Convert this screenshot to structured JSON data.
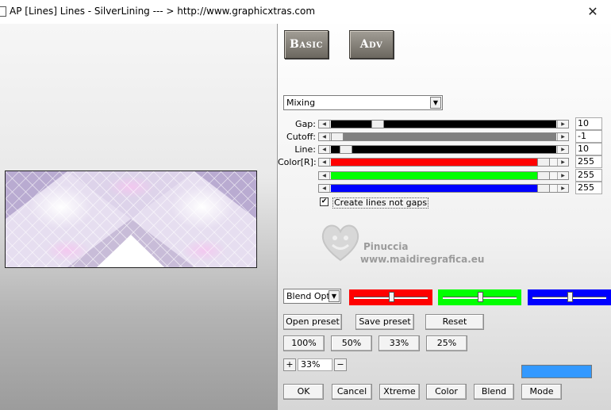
{
  "window": {
    "title": "AP [Lines]  Lines - SilverLining     --- > http://www.graphicxtras.com",
    "close": "✕"
  },
  "tabs": {
    "basic": "Basic",
    "adv": "Adv"
  },
  "mode_select": {
    "value": "Mixing",
    "arrow": "▼"
  },
  "sliders": [
    {
      "label": "Gap:",
      "value": "10",
      "fill_color": "#000000",
      "fill_fraction": 1.0,
      "thumb_fraction": 0.19
    },
    {
      "label": "Cutoff:",
      "value": "-1",
      "fill_color": "#808080",
      "fill_fraction": 1.0,
      "thumb_fraction": 0.0
    },
    {
      "label": "Line:",
      "value": "10",
      "fill_color": "#000000",
      "fill_fraction": 1.0,
      "thumb_fraction": 0.04
    },
    {
      "label": "Color[R]:",
      "value": "255",
      "fill_color": "#ff0000",
      "fill_fraction": 0.94,
      "thumb_fraction": 0.97
    },
    {
      "label": "",
      "value": "255",
      "fill_color": "#00ff00",
      "fill_fraction": 0.94,
      "thumb_fraction": 0.97
    },
    {
      "label": "",
      "value": "255",
      "fill_color": "#0000ff",
      "fill_fraction": 0.94,
      "thumb_fraction": 0.97
    }
  ],
  "create_lines_checkbox": {
    "label": "Create lines not gaps",
    "checked": true,
    "mark": "✔"
  },
  "watermark": {
    "line1": "Pinuccia",
    "line2": "www.maidiregrafica.eu"
  },
  "blend": {
    "select_value": "Blend Optio",
    "arrow": "▼",
    "color_sliders": [
      {
        "color": "#ff0000",
        "position_fraction": 0.5
      },
      {
        "color": "#00ff00",
        "position_fraction": 0.5
      },
      {
        "color": "#0000ff",
        "position_fraction": 0.5
      }
    ]
  },
  "preset_buttons": {
    "open": "Open preset",
    "save": "Save preset",
    "reset": "Reset"
  },
  "zoom_presets": [
    "100%",
    "50%",
    "33%",
    "25%"
  ],
  "zoom": {
    "plus": "+",
    "value": "33%",
    "minus": "−"
  },
  "swatch_color": "#3399ff",
  "bottom_buttons": [
    "OK",
    "Cancel",
    "Xtreme",
    "Color",
    "Blend",
    "Mode"
  ]
}
